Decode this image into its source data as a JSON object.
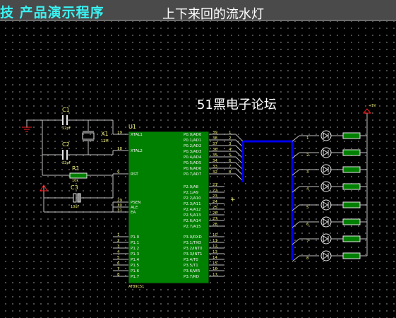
{
  "window": {
    "title_left": "技 产品演示程序",
    "title_main": "上下来回的流水灯"
  },
  "schematic": {
    "banner": "51黑电子论坛",
    "chip": {
      "ref": "U1",
      "part": "AT89C51",
      "left_pins": [
        {
          "num": "19",
          "name": "XTAL1"
        },
        {
          "num": "18",
          "name": "XTAL2"
        },
        {
          "num": "9",
          "name": "RST"
        },
        {
          "num": "29",
          "name": "PSEN"
        },
        {
          "num": "30",
          "name": "ALE"
        },
        {
          "num": "31",
          "name": "EA"
        },
        {
          "num": "1",
          "name": "P1.0"
        },
        {
          "num": "2",
          "name": "P1.1"
        },
        {
          "num": "3",
          "name": "P1.2"
        },
        {
          "num": "4",
          "name": "P1.3"
        },
        {
          "num": "5",
          "name": "P1.4"
        },
        {
          "num": "6",
          "name": "P1.5"
        },
        {
          "num": "7",
          "name": "P1.6"
        },
        {
          "num": "8",
          "name": "P1.7"
        }
      ],
      "right_pins": [
        {
          "num": "39",
          "name": "P0.0/AD0"
        },
        {
          "num": "38",
          "name": "P0.1/AD1"
        },
        {
          "num": "37",
          "name": "P0.2/AD2"
        },
        {
          "num": "36",
          "name": "P0.3/AD3"
        },
        {
          "num": "35",
          "name": "P0.4/AD4"
        },
        {
          "num": "34",
          "name": "P0.5/AD5"
        },
        {
          "num": "33",
          "name": "P0.6/AD6"
        },
        {
          "num": "32",
          "name": "P0.7/AD7"
        },
        {
          "num": "21",
          "name": "P2.0/A8"
        },
        {
          "num": "22",
          "name": "P2.1/A9"
        },
        {
          "num": "23",
          "name": "P2.2/A10"
        },
        {
          "num": "24",
          "name": "P2.3/A11"
        },
        {
          "num": "25",
          "name": "P2.4/A12"
        },
        {
          "num": "26",
          "name": "P2.5/A13"
        },
        {
          "num": "27",
          "name": "P2.6/A14"
        },
        {
          "num": "28",
          "name": "P2.7/A15"
        },
        {
          "num": "10",
          "name": "P3.0/RXD"
        },
        {
          "num": "11",
          "name": "P3.1/TXD"
        },
        {
          "num": "12",
          "name": "P3.2/INT0"
        },
        {
          "num": "13",
          "name": "P3.3/INT1"
        },
        {
          "num": "14",
          "name": "P3.4/T0"
        },
        {
          "num": "15",
          "name": "P3.5/T1"
        },
        {
          "num": "16",
          "name": "P3.6/WR"
        },
        {
          "num": "17",
          "name": "P3.7/RD"
        }
      ],
      "bus_pin_labels": [
        "1",
        "2",
        "3",
        "4",
        "5",
        "6",
        "7",
        "8"
      ]
    },
    "components": {
      "c1": {
        "ref": "C1",
        "value": "22pF"
      },
      "c2": {
        "ref": "C2",
        "value": "22pF"
      },
      "x1": {
        "ref": "X1",
        "value": "12M"
      },
      "r1": {
        "ref": "R1",
        "value": "10k"
      },
      "c3": {
        "ref": "C3",
        "value": "10uF"
      }
    },
    "power_label": "+5V",
    "led_labels": [
      "1",
      "2",
      "3",
      "4",
      "5",
      "6",
      "7",
      "8"
    ],
    "colors": {
      "chip_fill": "#008000",
      "wire": "#bfbfbf",
      "bus": "#0000ee",
      "part_outline": "#e8e8e8",
      "resistor_fill": "#008000",
      "power": "#ff2020",
      "label": "#f2f27a",
      "title_accent": "#3af2f2"
    }
  }
}
